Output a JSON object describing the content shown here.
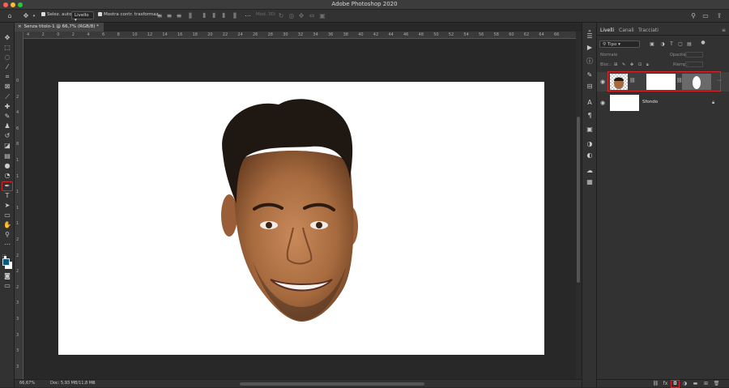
{
  "window": {
    "title": "Adobe Photoshop 2020"
  },
  "colors": {
    "close": "#ff5f57",
    "minimize": "#febc2e",
    "zoom": "#28c840",
    "highlight": "#d9242a",
    "foreground": "#0f5a7a",
    "background": "#ffffff"
  },
  "options_bar": {
    "home_icon": "home-icon",
    "move_tool_icon": "move-icon",
    "auto_select_label": "Selez. auto:",
    "auto_select_checked": true,
    "auto_select_target": "Livello",
    "show_transform_label": "Mostra contr. trasformaz.",
    "show_transform_checked": true,
    "mode_3d_label": "Mod. 3D:",
    "search_icon": "search-icon",
    "workspace_icon": "workspace-icon",
    "share_icon": "share-icon"
  },
  "document": {
    "tab_label": "Senza titolo-1 @ 66,7% (RGB/8) *",
    "zoom_status": "66,67%",
    "doc_status": "Doc: 5,93 MB/11,8 MB",
    "image_icon": "face-photo"
  },
  "ruler": {
    "h_ticks": [
      "4",
      "2",
      "0",
      "2",
      "4",
      "6",
      "8",
      "10",
      "12",
      "14",
      "16",
      "18",
      "20",
      "22",
      "24",
      "26",
      "28",
      "30",
      "32",
      "34",
      "36",
      "38",
      "40",
      "42",
      "44",
      "46",
      "48",
      "50",
      "52",
      "54",
      "56",
      "58",
      "60",
      "62",
      "64",
      "66"
    ],
    "v_ticks": [
      "0",
      "2",
      "4",
      "6",
      "8",
      "1",
      "1",
      "1",
      "1",
      "1",
      "2",
      "2",
      "2",
      "2",
      "3",
      "3",
      "3",
      "3",
      "3"
    ]
  },
  "tools": [
    {
      "name": "move-tool",
      "icon": "✥"
    },
    {
      "name": "marquee-tool",
      "icon": "⬚"
    },
    {
      "name": "lasso-tool",
      "icon": "◌"
    },
    {
      "name": "quick-select-tool",
      "icon": "⁄"
    },
    {
      "name": "crop-tool",
      "icon": "⌗"
    },
    {
      "name": "frame-tool",
      "icon": "⊠"
    },
    {
      "name": "eyedropper-tool",
      "icon": "⟋"
    },
    {
      "name": "healing-tool",
      "icon": "✚"
    },
    {
      "name": "brush-tool",
      "icon": "✎"
    },
    {
      "name": "stamp-tool",
      "icon": "♟"
    },
    {
      "name": "history-brush-tool",
      "icon": "↺"
    },
    {
      "name": "eraser-tool",
      "icon": "◪"
    },
    {
      "name": "gradient-tool",
      "icon": "▤"
    },
    {
      "name": "blur-tool",
      "icon": "●"
    },
    {
      "name": "dodge-tool",
      "icon": "◔"
    },
    {
      "name": "pen-tool",
      "icon": "✒"
    },
    {
      "name": "type-tool",
      "icon": "T"
    },
    {
      "name": "path-select-tool",
      "icon": "➤"
    },
    {
      "name": "rectangle-tool",
      "icon": "▭"
    },
    {
      "name": "hand-tool",
      "icon": "✋"
    },
    {
      "name": "zoom-tool",
      "icon": "⚲"
    },
    {
      "name": "more-tools",
      "icon": "⋯"
    }
  ],
  "panels": {
    "tabs": [
      {
        "label": "Livelli",
        "active": true
      },
      {
        "label": "Canali",
        "active": false
      },
      {
        "label": "Tracciati",
        "active": false
      }
    ],
    "filter_kind": "Tipo",
    "blend_mode": "Normale",
    "opacity_label": "Opacità:",
    "lock_label": "Bloc.:",
    "fill_label": "Riemp.:",
    "layers": [
      {
        "name": "",
        "has_mask": true,
        "visible": true,
        "selected": true
      },
      {
        "name": "Sfondo",
        "has_mask": false,
        "visible": true,
        "locked": true
      }
    ],
    "bottom_icons": [
      "link-icon",
      "fx-icon",
      "add-mask-icon",
      "adjustment-icon",
      "folder-icon",
      "new-layer-icon",
      "trash-icon"
    ]
  }
}
